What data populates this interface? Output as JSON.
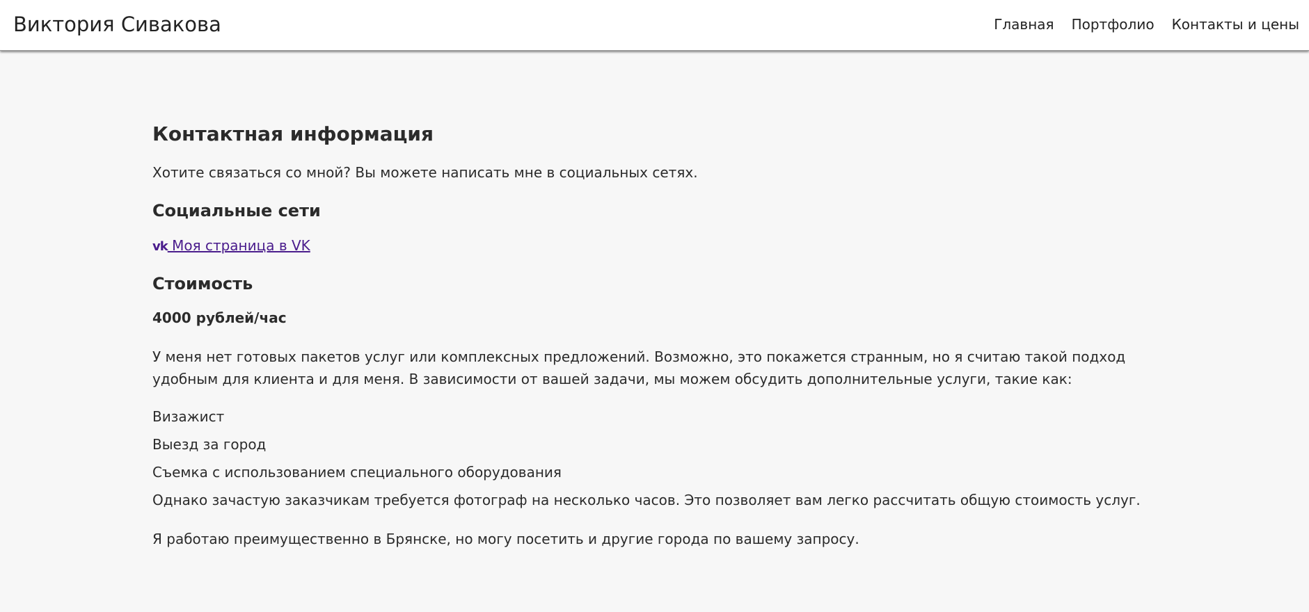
{
  "header": {
    "site_title": "Виктория Сивакова",
    "nav": [
      "Главная",
      "Портфолио",
      "Контакты и цены"
    ]
  },
  "main": {
    "title": "Контактная информация",
    "intro": "Хотите связаться со мной? Вы можете написать мне в социальных сетях.",
    "social_heading": "Социальные сети",
    "vk_link_text": " Моя страница в VK",
    "vk_icon": "vk-icon",
    "price_heading": "Стоимость",
    "price": "4000 рублей/час",
    "description": "У меня нет готовых пакетов услуг или комплексных предложений. Возможно, это покажется странным, но я считаю такой подход удобным для клиента и для меня. В зависимости от вашей задачи, мы можем обсудить дополнительные услуги, такие как:",
    "services": [
      "Визажист",
      "Выезд за город",
      "Съемка с использованием специального оборудования"
    ],
    "note1": "Однако зачастую заказчикам требуется фотограф на несколько часов. Это позволяет вам легко рассчитать общую стоимость услуг.",
    "note2": "Я работаю преимущественно в Брянске, но могу посетить и другие города по вашему запросу."
  },
  "colors": {
    "link": "#4a1c8c",
    "background": "#f7f7f7",
    "header_background": "#ffffff"
  }
}
